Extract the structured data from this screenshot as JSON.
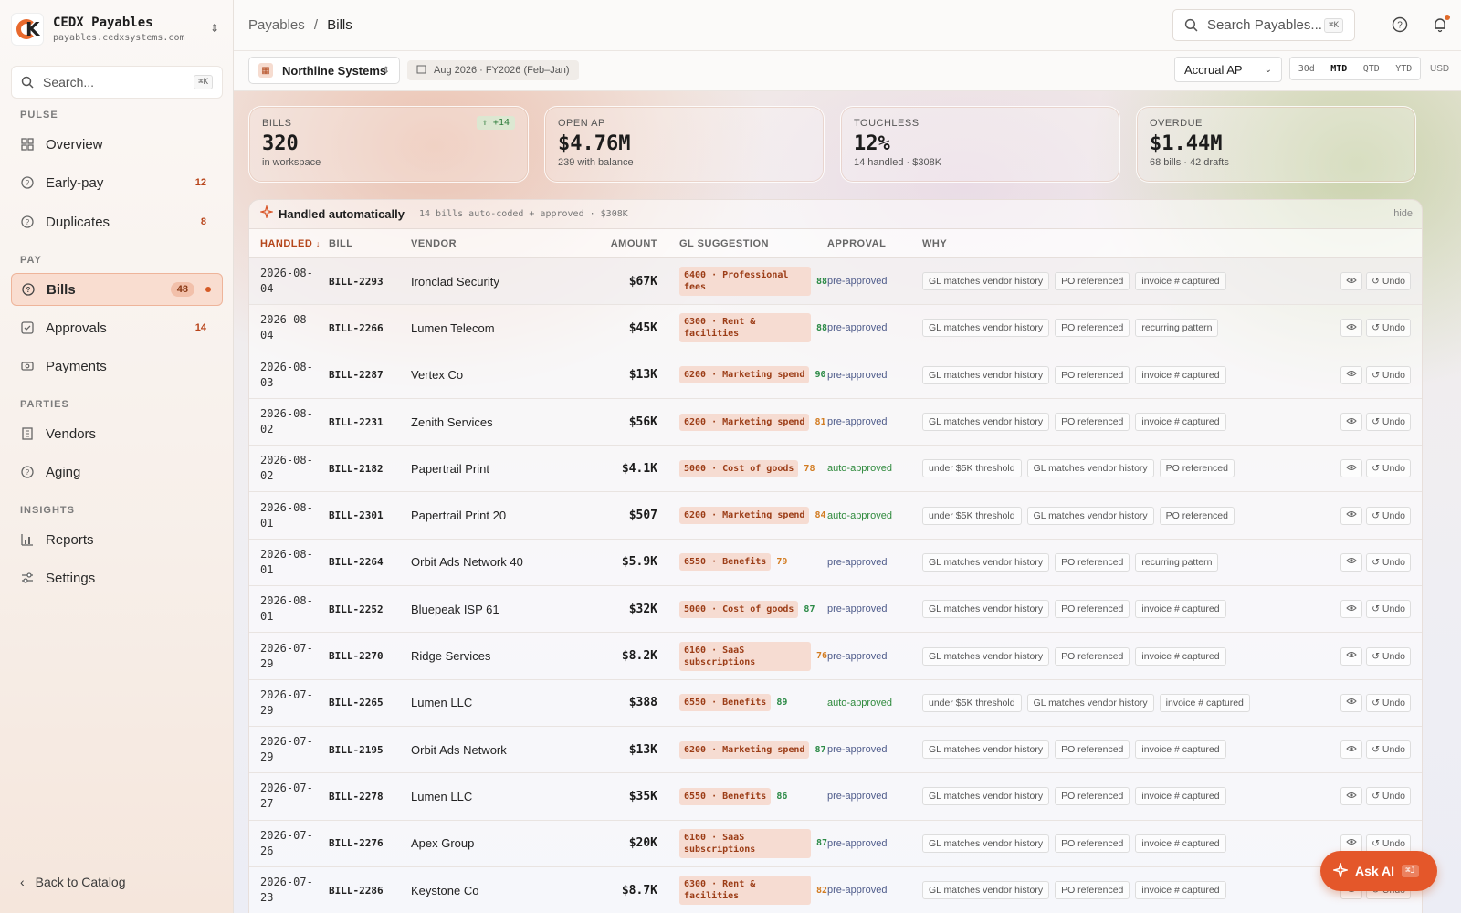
{
  "brand": {
    "title": "CEDX Payables",
    "domain": "payables.cedxsystems.com"
  },
  "sidebar": {
    "search_placeholder": "Search...",
    "search_kbd": "⌘K",
    "sections": {
      "pulse": "PULSE",
      "pay": "PAY",
      "parties": "PARTIES",
      "insights": "INSIGHTS"
    },
    "items": {
      "overview": {
        "label": "Overview"
      },
      "earlypay": {
        "label": "Early-pay",
        "count": "12"
      },
      "duplicates": {
        "label": "Duplicates",
        "count": "8"
      },
      "bills": {
        "label": "Bills",
        "count": "48"
      },
      "approvals": {
        "label": "Approvals",
        "count": "14"
      },
      "payments": {
        "label": "Payments"
      },
      "vendors": {
        "label": "Vendors"
      },
      "aging": {
        "label": "Aging"
      },
      "reports": {
        "label": "Reports"
      },
      "settings": {
        "label": "Settings"
      }
    },
    "back": "Back to Catalog"
  },
  "header": {
    "crumb_parent": "Payables",
    "crumb_sep": "/",
    "crumb_current": "Bills",
    "search_placeholder": "Search Payables...",
    "search_kbd": "⌘K"
  },
  "toolbar": {
    "entity": "Northline Systems",
    "period": "Aug 2026 · FY2026 (Feb–Jan)",
    "basis": "Accrual AP",
    "ranges": [
      "30d",
      "MTD",
      "QTD",
      "YTD"
    ],
    "active_range": "MTD",
    "currency": "USD"
  },
  "kpis": {
    "bills": {
      "label": "BILLS",
      "value": "320",
      "sub": "in workspace",
      "delta": "↑ +14"
    },
    "openap": {
      "label": "OPEN AP",
      "value": "$4.76M",
      "sub": "239 with balance"
    },
    "touchless": {
      "label": "TOUCHLESS",
      "value": "12%",
      "sub": "14 handled · $308K"
    },
    "overdue": {
      "label": "OVERDUE",
      "value": "$1.44M",
      "sub": "68 bills · 42 drafts"
    }
  },
  "panel": {
    "title": "Handled automatically",
    "info": "14 bills auto-coded + approved · $308K",
    "hide": "hide",
    "columns": {
      "handled": "HANDLED",
      "bill": "BILL",
      "vendor": "VENDOR",
      "amount": "AMOUNT",
      "gl": "GL SUGGESTION",
      "approval": "APPROVAL",
      "why": "WHY"
    },
    "sort_arrow": "↓",
    "undo_label": "Undo"
  },
  "rows": [
    {
      "date": "2026-08-04",
      "bill": "BILL-2293",
      "vendor": "Ironclad Security",
      "amount": "$67K",
      "gl": "6400 · Professional fees",
      "conf": "88",
      "approval": "pre-approved",
      "why": [
        "GL matches vendor history",
        "PO referenced",
        "invoice # captured"
      ]
    },
    {
      "date": "2026-08-04",
      "bill": "BILL-2266",
      "vendor": "Lumen Telecom",
      "amount": "$45K",
      "gl": "6300 · Rent & facilities",
      "conf": "88",
      "approval": "pre-approved",
      "why": [
        "GL matches vendor history",
        "PO referenced",
        "recurring pattern"
      ]
    },
    {
      "date": "2026-08-03",
      "bill": "BILL-2287",
      "vendor": "Vertex Co",
      "amount": "$13K",
      "gl": "6200 · Marketing spend",
      "conf": "90",
      "approval": "pre-approved",
      "why": [
        "GL matches vendor history",
        "PO referenced",
        "invoice # captured"
      ]
    },
    {
      "date": "2026-08-02",
      "bill": "BILL-2231",
      "vendor": "Zenith Services",
      "amount": "$56K",
      "gl": "6200 · Marketing spend",
      "conf": "81",
      "approval": "pre-approved",
      "why": [
        "GL matches vendor history",
        "PO referenced",
        "invoice # captured"
      ]
    },
    {
      "date": "2026-08-02",
      "bill": "BILL-2182",
      "vendor": "Papertrail Print",
      "amount": "$4.1K",
      "gl": "5000 · Cost of goods",
      "conf": "78",
      "approval": "auto-approved",
      "why": [
        "under $5K threshold",
        "GL matches vendor history",
        "PO referenced"
      ]
    },
    {
      "date": "2026-08-01",
      "bill": "BILL-2301",
      "vendor": "Papertrail Print 20",
      "amount": "$507",
      "gl": "6200 · Marketing spend",
      "conf": "84",
      "approval": "auto-approved",
      "why": [
        "under $5K threshold",
        "GL matches vendor history",
        "PO referenced"
      ]
    },
    {
      "date": "2026-08-01",
      "bill": "BILL-2264",
      "vendor": "Orbit Ads Network 40",
      "amount": "$5.9K",
      "gl": "6550 · Benefits",
      "conf": "79",
      "approval": "pre-approved",
      "why": [
        "GL matches vendor history",
        "PO referenced",
        "recurring pattern"
      ]
    },
    {
      "date": "2026-08-01",
      "bill": "BILL-2252",
      "vendor": "Bluepeak ISP 61",
      "amount": "$32K",
      "gl": "5000 · Cost of goods",
      "conf": "87",
      "approval": "pre-approved",
      "why": [
        "GL matches vendor history",
        "PO referenced",
        "invoice # captured"
      ]
    },
    {
      "date": "2026-07-29",
      "bill": "BILL-2270",
      "vendor": "Ridge Services",
      "amount": "$8.2K",
      "gl": "6160 · SaaS subscriptions",
      "conf": "76",
      "approval": "pre-approved",
      "why": [
        "GL matches vendor history",
        "PO referenced",
        "invoice # captured"
      ]
    },
    {
      "date": "2026-07-29",
      "bill": "BILL-2265",
      "vendor": "Lumen LLC",
      "amount": "$388",
      "gl": "6550 · Benefits",
      "conf": "89",
      "approval": "auto-approved",
      "why": [
        "under $5K threshold",
        "GL matches vendor history",
        "invoice # captured"
      ]
    },
    {
      "date": "2026-07-29",
      "bill": "BILL-2195",
      "vendor": "Orbit Ads Network",
      "amount": "$13K",
      "gl": "6200 · Marketing spend",
      "conf": "87",
      "approval": "pre-approved",
      "why": [
        "GL matches vendor history",
        "PO referenced",
        "invoice # captured"
      ]
    },
    {
      "date": "2026-07-27",
      "bill": "BILL-2278",
      "vendor": "Lumen LLC",
      "amount": "$35K",
      "gl": "6550 · Benefits",
      "conf": "86",
      "approval": "pre-approved",
      "why": [
        "GL matches vendor history",
        "PO referenced",
        "invoice # captured"
      ]
    },
    {
      "date": "2026-07-26",
      "bill": "BILL-2276",
      "vendor": "Apex Group",
      "amount": "$20K",
      "gl": "6160 · SaaS subscriptions",
      "conf": "87",
      "approval": "pre-approved",
      "why": [
        "GL matches vendor history",
        "PO referenced",
        "invoice # captured"
      ]
    },
    {
      "date": "2026-07-23",
      "bill": "BILL-2286",
      "vendor": "Keystone Co",
      "amount": "$8.7K",
      "gl": "6300 · Rent & facilities",
      "conf": "82",
      "approval": "pre-approved",
      "why": [
        "GL matches vendor history",
        "PO referenced",
        "invoice # captured"
      ]
    }
  ],
  "ask_ai": {
    "label": "Ask AI",
    "kbd": "⌘J"
  }
}
